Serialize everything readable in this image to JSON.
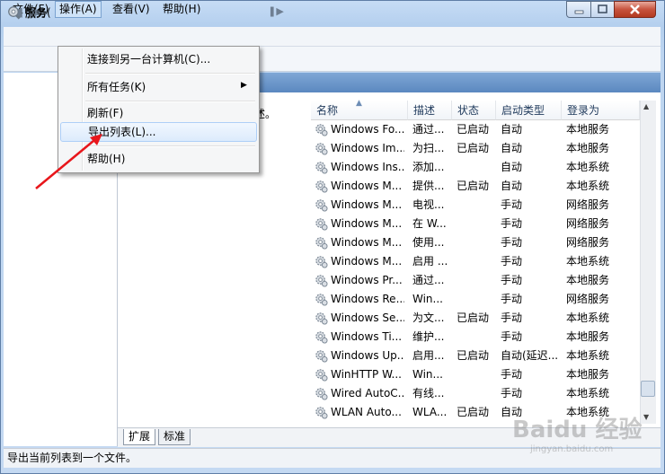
{
  "window": {
    "title": "服务"
  },
  "menubar": {
    "file": "文件(F)",
    "action": "操作(A)",
    "view": "查看(V)",
    "help": "帮助(H)"
  },
  "tree": {
    "root_label": "服务("
  },
  "right": {
    "desc_fragment": "述。"
  },
  "dropdown": {
    "connect": "连接到另一台计算机(C)...",
    "all_tasks": "所有任务(K)",
    "refresh": "刷新(F)",
    "export": "导出列表(L)...",
    "help": "帮助(H)"
  },
  "table": {
    "columns": {
      "name": "名称",
      "desc": "描述",
      "status": "状态",
      "startup": "启动类型",
      "logon": "登录为"
    },
    "rows": [
      {
        "name": "Windows Fo...",
        "desc": "通过...",
        "status": "已启动",
        "startup": "自动",
        "logon": "本地服务"
      },
      {
        "name": "Windows Im...",
        "desc": "为扫...",
        "status": "已启动",
        "startup": "自动",
        "logon": "本地服务"
      },
      {
        "name": "Windows Ins...",
        "desc": "添加...",
        "status": "",
        "startup": "自动",
        "logon": "本地系统"
      },
      {
        "name": "Windows M...",
        "desc": "提供...",
        "status": "已启动",
        "startup": "自动",
        "logon": "本地系统"
      },
      {
        "name": "Windows M...",
        "desc": "电视...",
        "status": "",
        "startup": "手动",
        "logon": "网络服务"
      },
      {
        "name": "Windows M...",
        "desc": "在 W...",
        "status": "",
        "startup": "手动",
        "logon": "网络服务"
      },
      {
        "name": "Windows M...",
        "desc": "使用...",
        "status": "",
        "startup": "手动",
        "logon": "网络服务"
      },
      {
        "name": "Windows M...",
        "desc": "启用 ...",
        "status": "",
        "startup": "手动",
        "logon": "本地系统"
      },
      {
        "name": "Windows Pr...",
        "desc": "通过...",
        "status": "",
        "startup": "手动",
        "logon": "本地服务"
      },
      {
        "name": "Windows Re...",
        "desc": "Win...",
        "status": "",
        "startup": "手动",
        "logon": "网络服务"
      },
      {
        "name": "Windows Se...",
        "desc": "为文...",
        "status": "已启动",
        "startup": "手动",
        "logon": "本地系统"
      },
      {
        "name": "Windows Ti...",
        "desc": "维护...",
        "status": "",
        "startup": "手动",
        "logon": "本地服务"
      },
      {
        "name": "Windows Up...",
        "desc": "启用...",
        "status": "已启动",
        "startup": "自动(延迟...",
        "logon": "本地系统"
      },
      {
        "name": "WinHTTP W...",
        "desc": "Win...",
        "status": "",
        "startup": "手动",
        "logon": "本地服务"
      },
      {
        "name": "Wired AutoC...",
        "desc": "有线...",
        "status": "",
        "startup": "手动",
        "logon": "本地系统"
      },
      {
        "name": "WLAN Auto...",
        "desc": "WLA...",
        "status": "已启动",
        "startup": "自动",
        "logon": "本地系统"
      }
    ]
  },
  "tabs": {
    "extended": "扩展",
    "standard": "标准"
  },
  "status_bar": {
    "text": "导出当前列表到一个文件。"
  },
  "watermark": {
    "brand": "Baidu 经验",
    "url": "jingyan.baidu.com"
  },
  "colors": {
    "accent": "#5b88c0",
    "annotation": "#e8161b"
  }
}
